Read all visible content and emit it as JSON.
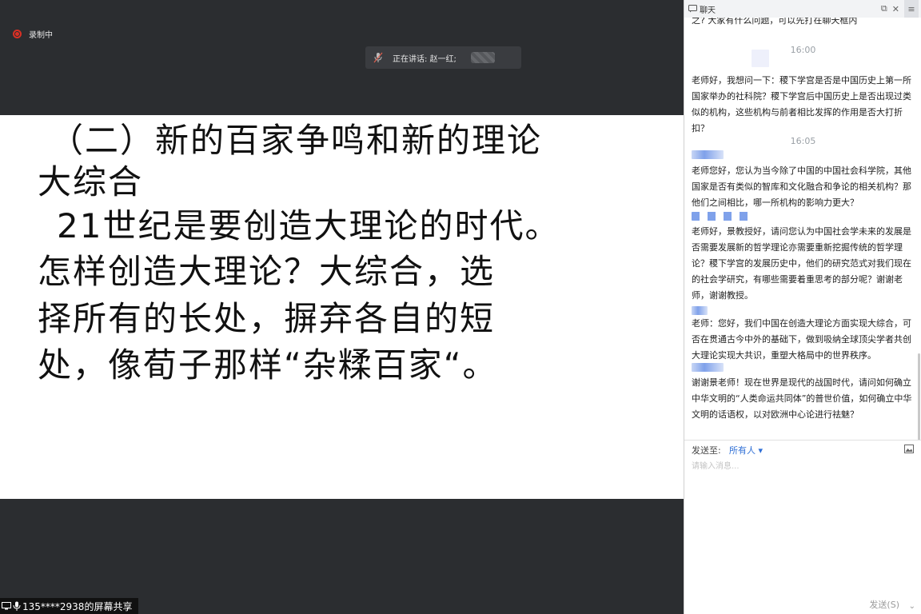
{
  "recording": {
    "label": "录制中",
    "color": "#d93025"
  },
  "speaking": {
    "label": "正在讲话: 赵一红;"
  },
  "slide": {
    "lines": [
      "（二）新的百家争鸣和新的理论",
      "大综合",
      "21世纪是要创造大理论的时代。",
      "怎样创造大理论？大综合，选",
      "择所有的长处，摒弃各自的短",
      "处，像荀子那样“杂糅百家“。"
    ]
  },
  "screen_share": {
    "label": "135****2938的屏幕共享"
  },
  "chat": {
    "title": "聊天",
    "messages": [
      {
        "text": "之?                      大家有什么问题，可以先打在聊天框内"
      },
      {
        "timestamp": "16:00"
      },
      {
        "text": "老师好，我想问一下：稷下学宫是否是中国历史上第一所国家举办的社科院？稷下学宫后中国历史上是否出现过类似的机构，这些机构与前者相比发挥的作用是否大打折扣？"
      },
      {
        "timestamp": "16:05"
      },
      {
        "text": "老师您好，您认为当今除了中国的中国社会科学院，其他国家是否有类似的智库和文化融合和争论的相关机构？那他们之间相比，哪一所机构的影响力更大？"
      },
      {
        "text": "老师好，景教授好，请问您认为中国社会学未来的发展是否需要发展新的哲学理论亦需要重新挖掘传统的哲学理论？稷下学宫的发展历史中，他们的研究范式对我们现在的社会学研究，有哪些需要着重思考的部分呢？谢谢老师，谢谢教授。"
      },
      {
        "text": "老师：您好，我们中国在创造大理论方面实现大综合，可否在贯通古今中外的基础下，做到吸纳全球顶尖学者共创大理论实现大共识，重塑大格局中的世界秩序。"
      },
      {
        "text": "谢谢景老师！现在世界是现代的战国时代，请问如何确立中华文明的“人类命运共同体”的普世价值，如何确立中华文明的话语权，以对欧洲中心论进行祛魅？"
      }
    ],
    "send_to_label": "发送至:",
    "send_target": "所有人 ▾",
    "input_placeholder": "请输入消息...",
    "send_label": "发送(S)",
    "send_more": "⌄",
    "accent": "#2f6fd6"
  }
}
